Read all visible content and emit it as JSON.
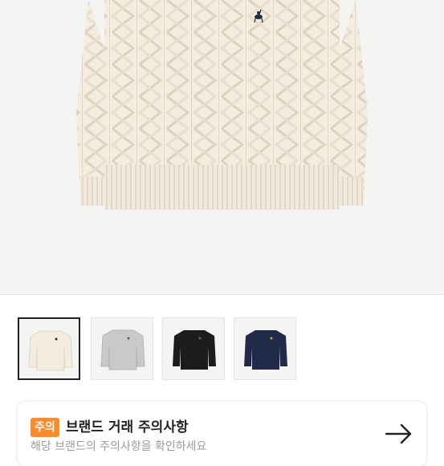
{
  "product": {
    "main_image": "cream cable-knit sweater with navy pony logo",
    "thumbnails": [
      {
        "label": "cream",
        "color": "#f3ecdf",
        "logo_color": "#1c2a4a",
        "selected": true
      },
      {
        "label": "gray",
        "color": "#c9c9c9",
        "logo_color": "#5c5c5c",
        "selected": false
      },
      {
        "label": "black",
        "color": "#1c1c1c",
        "logo_color": "#666666",
        "selected": false
      },
      {
        "label": "navy",
        "color": "#222a4a",
        "logo_color": "#c9a23a",
        "selected": false
      }
    ]
  },
  "notice": {
    "badge": "주의",
    "title": "브랜드 거래 주의사항",
    "subtitle": "해당 브랜드의 주의사항을 확인하세요",
    "badge_color": "#ff8a2a",
    "arrow_icon": "arrow-right-icon"
  }
}
